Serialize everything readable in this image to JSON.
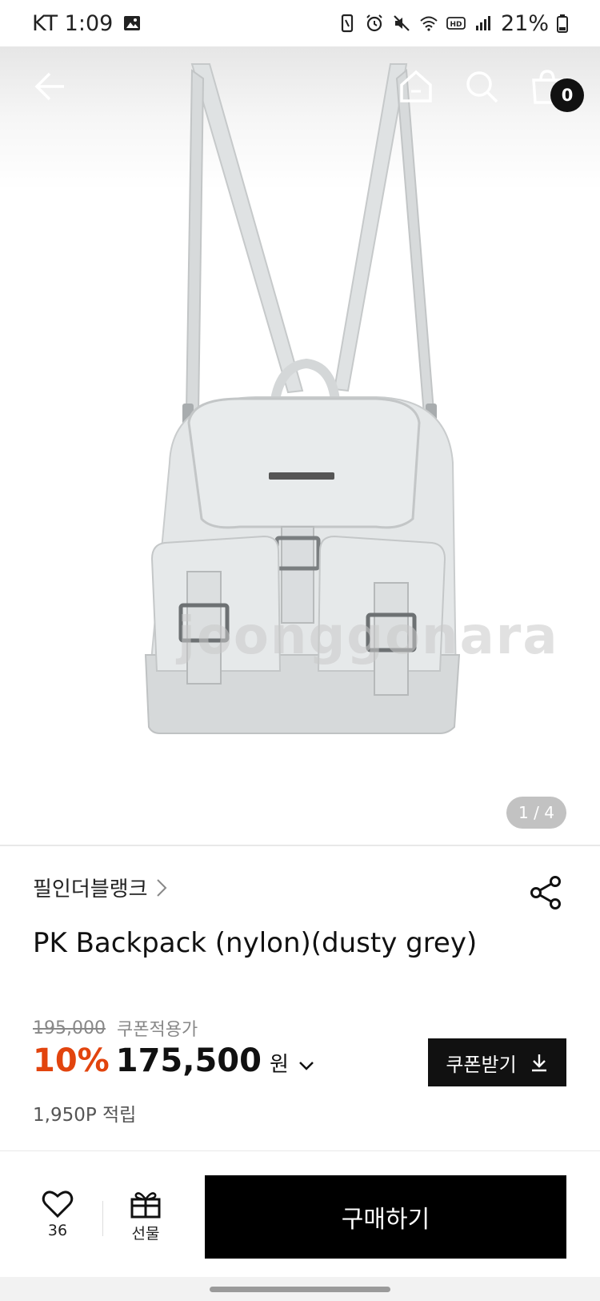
{
  "status_bar": {
    "carrier_time": "KT 1:09",
    "battery": "21%"
  },
  "nav": {
    "cart_count": "0"
  },
  "gallery": {
    "pager": "1 / 4",
    "watermark": "joonggonara"
  },
  "product": {
    "brand": "필인더블랭크",
    "title": "PK Backpack (nylon)(dusty grey)",
    "original_price": "195,000",
    "coupon_note": "쿠폰적용가",
    "discount": "10%",
    "price": "175,500",
    "currency": "원",
    "points": "1,950P 적립"
  },
  "coupon_button": {
    "label": "쿠폰받기"
  },
  "bottom_bar": {
    "like_count": "36",
    "gift_label": "선물",
    "buy_label": "구매하기"
  },
  "colors": {
    "accent_discount": "#e2440e",
    "button_dark": "#111111"
  },
  "icons": [
    "back-arrow-icon",
    "home-icon",
    "search-icon",
    "shopping-bag-icon",
    "share-icon",
    "download-icon",
    "heart-icon",
    "gift-icon",
    "chevron-right-icon",
    "chevron-down-icon"
  ]
}
